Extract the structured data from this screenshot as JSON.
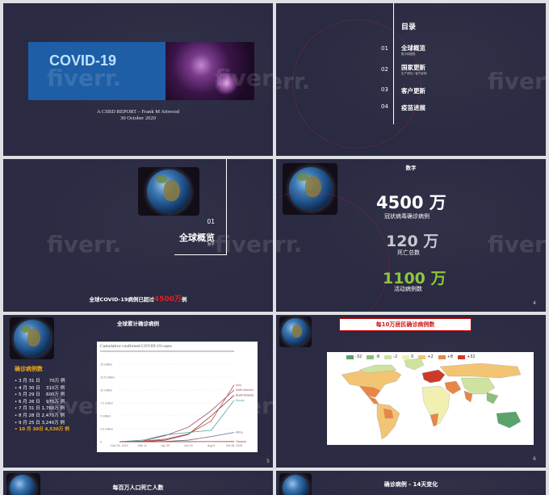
{
  "watermark": "fiverr.",
  "slide1": {
    "banner_title": "COVID-19",
    "report_line": "A CSBD REPORT – Frank M Attwood",
    "date_line": "30 October 2020"
  },
  "slide2": {
    "toc_title": "目录",
    "items": [
      {
        "num": "01",
        "label": "全球概览",
        "sub": "数字和图表"
      },
      {
        "num": "02",
        "label": "国家更新",
        "sub": "生产风险 / 客户影响"
      },
      {
        "num": "03",
        "label": "客户更新",
        "sub": ""
      },
      {
        "num": "04",
        "label": "疫苗进展",
        "sub": ""
      }
    ]
  },
  "slide3": {
    "num": "01",
    "title": "全球概览",
    "sub": "数字",
    "footer_prefix": "全球COVID-19病例已超过",
    "footer_highlight": "4500万",
    "footer_suffix": "例"
  },
  "slide4": {
    "header": "数字",
    "stat1_value": "4500 万",
    "stat1_label": "冠状病毒确诊病例",
    "stat2_value": "120 万",
    "stat2_label": "死亡总数",
    "stat3_value": "1100 万",
    "stat3_label": "活动病例数",
    "page": "4",
    "colors": {
      "stat3": "#8ec63f"
    }
  },
  "slide5": {
    "title": "全球累计确诊病例",
    "list_title": "确诊病例数",
    "rows": [
      "3 月 31 日　　70万 例",
      "4 月 30 日　 310万 例",
      "5 月 29 日　 600万 例",
      "6 月 26 日　 970万 例",
      "7 月 31 日 1,760万 例",
      "8 月 28 日 2,470万 例",
      "9 月 25 日 3,240万 例",
      "10 月 30日 4,530万 例"
    ],
    "chart_title": "Cumulative confirmed COVID-19 cases",
    "page": "5"
  },
  "chart_data": {
    "type": "line",
    "title": "Cumulative confirmed COVID-19 cases",
    "x": [
      "Dec 31, 2019",
      "Mar 11",
      "Apr 30",
      "Jun 19",
      "Aug 8",
      "Oct 28, 2020"
    ],
    "y_ticks": [
      "15 million",
      "12.5 million",
      "10 million",
      "7.5 million",
      "5 million",
      "2.5 million",
      "0"
    ],
    "ylim": [
      0,
      15
    ],
    "series": [
      {
        "name": "Asia",
        "color": "#c0504d",
        "values": [
          0,
          0.1,
          0.5,
          1.5,
          4,
          11
        ]
      },
      {
        "name": "North America",
        "color": "#a0406a",
        "values": [
          0,
          0.1,
          1.2,
          2.8,
          6,
          10
        ]
      },
      {
        "name": "South America",
        "color": "#7a3a2a",
        "values": [
          0,
          0,
          0.3,
          1.4,
          5,
          9
        ]
      },
      {
        "name": "Europe",
        "color": "#4aa3a0",
        "values": [
          0,
          0.3,
          1.3,
          1.8,
          2.2,
          8
        ]
      },
      {
        "name": "Africa",
        "color": "#6a6a8a",
        "values": [
          0,
          0,
          0.05,
          0.3,
          1,
          1.8
        ]
      },
      {
        "name": "Oceania",
        "color": "#b03030",
        "values": [
          0,
          0,
          0,
          0.01,
          0.02,
          0.03
        ]
      }
    ]
  },
  "slide6": {
    "title": "每10万居民确诊病例数",
    "legend": [
      {
        "label": "-32",
        "color": "#5aa36b"
      },
      {
        "label": "-8",
        "color": "#8cc07a"
      },
      {
        "label": "-2",
        "color": "#cfe3a0"
      },
      {
        "label": "0",
        "color": "#f2f0b0"
      },
      {
        "label": "+2",
        "color": "#f3c474"
      },
      {
        "label": "+8",
        "color": "#e88646"
      },
      {
        "label": "+32",
        "color": "#cc3a2a"
      }
    ],
    "page": "6"
  },
  "slide7": {
    "title": "每百万人口死亡人数"
  },
  "slide8": {
    "title": "确诊病例 - 14天变化"
  }
}
